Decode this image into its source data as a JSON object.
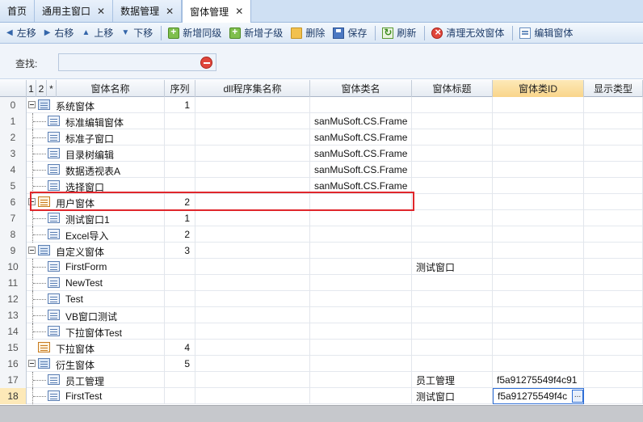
{
  "tabs": [
    {
      "label": "首页",
      "closable": false,
      "active": false
    },
    {
      "label": "通用主窗口",
      "closable": true,
      "active": false
    },
    {
      "label": "数据管理",
      "closable": true,
      "active": false
    },
    {
      "label": "窗体管理",
      "closable": true,
      "active": true
    }
  ],
  "toolbar": {
    "left": "左移",
    "right": "右移",
    "up": "上移",
    "down": "下移",
    "add_sibling": "新增同级",
    "add_child": "新增子级",
    "delete": "删除",
    "save": "保存",
    "refresh": "刷新",
    "clear_invalid": "清理无效窗体",
    "edit_form": "编辑窗体"
  },
  "search": {
    "label": "查找:",
    "value": ""
  },
  "grid": {
    "header_marks": [
      "1",
      "2",
      "*"
    ],
    "columns": [
      "窗体名称",
      "序列",
      "dll程序集名称",
      "窗体类名",
      "窗体标题",
      "窗体类ID",
      "显示类型"
    ],
    "selected_column": "窗体类ID",
    "rows": [
      {
        "n": "0",
        "name": "系统窗体",
        "seq": "1",
        "dll": "",
        "cls": "",
        "title": "",
        "id": ""
      },
      {
        "n": "1",
        "name": "标准编辑窗体",
        "seq": "",
        "dll": "",
        "cls": "sanMuSoft.CS.Frame",
        "title": "",
        "id": ""
      },
      {
        "n": "2",
        "name": "标准子窗口",
        "seq": "",
        "dll": "",
        "cls": "sanMuSoft.CS.Frame",
        "title": "",
        "id": ""
      },
      {
        "n": "3",
        "name": "目录树编辑",
        "seq": "",
        "dll": "",
        "cls": "sanMuSoft.CS.Frame",
        "title": "",
        "id": ""
      },
      {
        "n": "4",
        "name": "数据透视表A",
        "seq": "",
        "dll": "",
        "cls": "sanMuSoft.CS.Frame",
        "title": "",
        "id": ""
      },
      {
        "n": "5",
        "name": "选择窗口",
        "seq": "",
        "dll": "",
        "cls": "sanMuSoft.CS.Frame",
        "title": "",
        "id": ""
      },
      {
        "n": "6",
        "name": "用户窗体",
        "seq": "2",
        "dll": "",
        "cls": "",
        "title": "",
        "id": ""
      },
      {
        "n": "7",
        "name": "测试窗口1",
        "seq": "1",
        "dll": "",
        "cls": "",
        "title": "",
        "id": ""
      },
      {
        "n": "8",
        "name": "Excel导入",
        "seq": "2",
        "dll": "",
        "cls": "",
        "title": "",
        "id": ""
      },
      {
        "n": "9",
        "name": "自定义窗体",
        "seq": "3",
        "dll": "",
        "cls": "",
        "title": "",
        "id": ""
      },
      {
        "n": "10",
        "name": "FirstForm",
        "seq": "",
        "dll": "",
        "cls": "",
        "title": "测试窗口",
        "id": ""
      },
      {
        "n": "11",
        "name": "NewTest",
        "seq": "",
        "dll": "",
        "cls": "",
        "title": "",
        "id": ""
      },
      {
        "n": "12",
        "name": "Test",
        "seq": "",
        "dll": "",
        "cls": "",
        "title": "",
        "id": ""
      },
      {
        "n": "13",
        "name": "VB窗口测试",
        "seq": "",
        "dll": "",
        "cls": "",
        "title": "",
        "id": ""
      },
      {
        "n": "14",
        "name": "下拉窗体Test",
        "seq": "",
        "dll": "",
        "cls": "",
        "title": "",
        "id": ""
      },
      {
        "n": "15",
        "name": "下拉窗体",
        "seq": "4",
        "dll": "",
        "cls": "",
        "title": "",
        "id": ""
      },
      {
        "n": "16",
        "name": "衍生窗体",
        "seq": "5",
        "dll": "",
        "cls": "",
        "title": "",
        "id": ""
      },
      {
        "n": "17",
        "name": "员工管理",
        "seq": "",
        "dll": "",
        "cls": "",
        "title": "员工管理",
        "id": "f5a91275549f4c91"
      },
      {
        "n": "18",
        "name": "FirstTest",
        "seq": "",
        "dll": "",
        "cls": "",
        "title": "测试窗口",
        "id": "f5a91275549f4c"
      }
    ],
    "current_row": "18",
    "edit_button_label": "..."
  }
}
